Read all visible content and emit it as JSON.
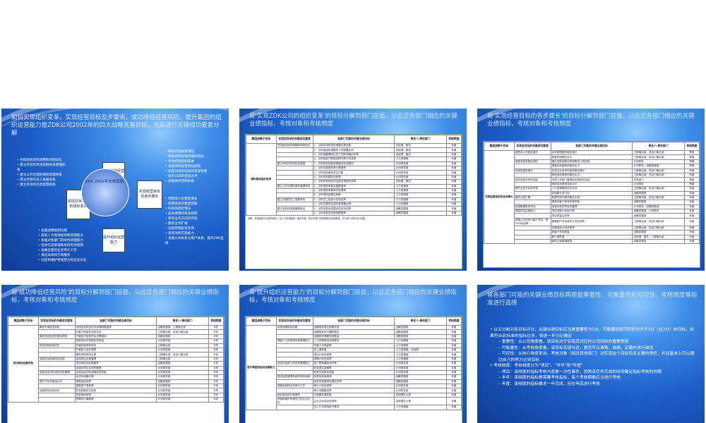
{
  "slides": [
    {
      "title": "如何实现组织变革，实现经营目标及步骤表，成功降低经营风险，提升集团的组织运营能力是ZDK公司2002年的四大战略发展目标，对其进行关键成功要素分解",
      "center": "ZDK 2002年总体目标",
      "boxes": {
        "top": "成功降低经营风险",
        "left": "实现ZDK公司的组织变革",
        "right": "实现经营目标的各步骤长",
        "bottom": "提升组织运营能力"
      },
      "left_list": [
        "完成组织结构调整和体制优化",
        "建立有效的风险控制体系管理体系",
        "建立公开合理的绩效管理体系",
        "建立完善的员工发展体系",
        "建立有效的信息管理系统"
      ],
      "right_list": [
        "降低市场投资风险",
        "降低项目投资的整体风险",
        "有效控制控制成本",
        "加强项目经营风险控制",
        "加强对经济利润的有效管理",
        "提升ZDK的营运水平",
        "加强财务控制体系"
      ],
      "right_list2": [
        "销售收入的稳定增长",
        "使营收息的稳定回收",
        "利润的稳定增长",
        "成本费用的有效控制",
        "新的业务方向的开拓",
        "服务业务扩展",
        "加强管理投资项目",
        "提高项目实施能力",
        "发展公共关系与客户关系，提升ZDK品牌"
      ],
      "bottom_list": [
        "加强战略规划功能",
        "提高人力资源规划和管理能力",
        "加强对各部门的财务管理能力",
        "促进信息管理系统的有效使用",
        "准确全面的业务审计工作",
        "保证高效的行政服务",
        "创造和维护有规范力的企业文化"
      ]
    },
    {
      "title": "将'实现ZDK公司的组织变革'的目标分解到部门层面，以此定各部门相应的关键业绩指标，考核对象和考核频度",
      "headers": [
        "集团战略子目标",
        "实现该目标的关键成功要素",
        "各部门可能的关键业绩目标",
        "责任人/责任部门",
        "考核频度"
      ],
      "group": "顺利推进组织变革",
      "rows": [
        [
          "完成组织结构调整和体制优化",
          "1、当前年组织架构调整实施进度",
          "总经理、副总",
          "年度"
        ],
        [
          "",
          "2、当年度组织调整的人员配置比例",
          "总经理、副总",
          "年度"
        ],
        [
          "",
          "3、当年度管理岗位员工任职资格达标率",
          "总经理、副总",
          "年度"
        ],
        [
          "",
          "4、当年各部门职能说明书修订完成率",
          "人力资源部",
          "年度"
        ],
        [
          "建立有效的风险防控制度",
          "1、当年风险控制制度建设完成情况",
          "计划财务部",
          "年度"
        ],
        [
          "",
          "2、当年内部风险审计覆盖率",
          "计划财务部",
          "年度"
        ],
        [
          "",
          "3、当年风险事件发生次数",
          "计划财务部",
          "年度"
        ],
        [
          "",
          "4、当年风险整改完成率",
          "计划财务部",
          "年度"
        ],
        [
          "",
          "5、当年投资风险评估报告按期完成率",
          "总经理、副总",
          "年度"
        ],
        [
          "建立公开合理的绩效管理体系",
          "1、当年绩效考核实施覆盖率",
          "人力资源部",
          "年度"
        ],
        [
          "",
          "2、当年绩效考核申诉处理率",
          "人力资源部",
          "年度"
        ],
        [
          "",
          "3、当年绩效结果应用率",
          "人力资源部",
          "年度"
        ],
        [
          "建立完善的员工发展体系",
          "1、当年员工培训计划完成率",
          "人力资源部",
          "年度"
        ],
        [
          "",
          "2、当年关键岗位继任者储备比例",
          "人力资源部",
          "年度"
        ],
        [
          "建立有效的信息管理系统",
          "1、当年信息系统建设项目完成率",
          "战略发展部",
          "年度"
        ],
        [
          "",
          "2、当年信息系统使用覆盖率",
          "战略发展部",
          "年度"
        ]
      ],
      "note": "说明：考核频度为年度的指标，由人力资源部统一组织考核；各责任部门须按期提交考核数据，作为部门绩效评价依据。"
    },
    {
      "title": "将'实现经营目标的各步骤长'的目标分解到部门层面，以此定各部门相应的关键业绩指标，考核对象和考核频度",
      "headers": [
        "集团战略子目标",
        "实现该目标的关键成功要素",
        "各部门可能的关键业绩目标",
        "责任人/责任部门",
        "考核频度"
      ],
      "group": "实现经营目标的各步骤长",
      "rows": [
        [
          "销售收入的稳定增长",
          "实现销售额的稳定增长",
          "工程事业部、进出口事业部",
          "季度"
        ],
        [
          "",
          "提高利润率的水平",
          "工程事业部、进出口事业部",
          "季度"
        ],
        [
          "使营收息的稳定回收",
          "通过控制回款实现销售收入的回收",
          "计划财务",
          "季度"
        ],
        [
          "",
          "提高应收账款的回收水平",
          "计划财务、战略发展部",
          "季度"
        ],
        [
          "利润的稳定增长",
          "实现主业务净利润的稳定增长",
          "工程事业部、进出口事业部",
          "年度"
        ],
        [
          "",
          "降低成本费用的增长水平",
          "工程事业部、进出口事业部",
          "年度"
        ],
        [
          "成本费用的有效控制",
          "本部门本部门管理成本费用的控制",
          "所有部门",
          "季度"
        ],
        [
          "",
          "降低成本费用总体水平",
          "计划财务",
          "季度"
        ],
        [
          "新的业务方向的开拓",
          "人力资源推荐业务方向",
          "工程事业部、进出口事业部",
          "年度"
        ],
        [
          "",
          "实现新业务方向",
          "战略发展部",
          "年度"
        ],
        [
          "服务业务扩展",
          "拓展市场中服务增长比例",
          "工程事业部、进出口事业部",
          "年度"
        ],
        [
          "",
          "提高对客户服务的满意度",
          "战略发展部",
          "年度"
        ],
        [
          "加强管理投资项目",
          "加强对投资项目的管理",
          "计划财务、战略发展部",
          "年度"
        ],
        [
          "提高项目实施能力",
          "项目进度计划执行率",
          "战略发展部、计划财务",
          "年度"
        ],
        [
          "",
          "项目质量达标率",
          "战略发展部",
          "年度"
        ],
        [
          "发展公共关系与客户关系，提升ZDK品牌",
          "重要客户关系维护计划完成率",
          "工程事业部、进出口事业部",
          "年度"
        ],
        [
          "",
          "品牌宣传计划完成率",
          "工程事业部、进出口事业部",
          "年度"
        ],
        [
          "",
          "新客户开发数量",
          "战略发展部",
          "年度"
        ],
        [
          "",
          "客户满意度",
          "总经理、副总、工程事业部",
          "年度"
        ],
        [
          "",
          "媒体正面报道数量",
          "战略发展部",
          "年度"
        ]
      ]
    },
    {
      "title": "将'成功降低经营风险'的目标分解到部门层面，以此定各部门相应的关键业绩指标，考核对象和考核频度",
      "headers": [
        "集团战略子目标",
        "实现该目标的关键成功要素",
        "各部门可能的关键业绩目标",
        "责任人/责任部门",
        "考核频度"
      ],
      "group": "成功降低经营风险",
      "rows": [
        [
          "降低市场投资风险",
          "对拟投资项目的市场调研覆盖率",
          "战略发展部、工程事业部",
          "半年"
        ],
        [
          "",
          "对客户信用状况的评估",
          "工程事业部、进出口事业部",
          "半年"
        ],
        [
          "降低项目投资的整体风险",
          "严格执行投资项目决策程序",
          "战略发展部",
          "半年"
        ],
        [
          "",
          "提高项目可研报告的质量",
          "计划财务部",
          "半年"
        ],
        [
          "有效控制控制成本",
          "严格控制采购成本",
          "工程事业部",
          "半年"
        ],
        [
          "",
          "严格执行成本预算",
          "计划财务部",
          "半年"
        ],
        [
          "",
          "降低采购成本比率",
          "工程事业部、进出口事业部",
          "半年"
        ],
        [
          "加强项目经营风险控制",
          "加强项目过程管理",
          "工程事业部",
          "半年"
        ],
        [
          "",
          "项目风险评估覆盖率",
          "战略发展部",
          "半年"
        ],
        [
          "",
          "加强对项目合同的管理",
          "计划财务部",
          "半年"
        ],
        [
          "加强对经济利润的有效管理",
          "加强对经济利润指标的控制",
          "计划财务部",
          "半年"
        ],
        [
          "",
          "经济利润增长率",
          "计划财务部",
          "半年"
        ],
        [
          "提升ZDK的营运水平",
          "提高营运效率",
          "战略发展部",
          "半年"
        ],
        [
          "",
          "提高资产周转率",
          "计划财务部",
          "半年"
        ],
        [
          "加强财务控制体系",
          "财务制度执行检查",
          "计划财务部",
          "半年"
        ],
        [
          "",
          "资金使用效率",
          "计划财务部",
          "半年"
        ],
        [
          "",
          "预算执行偏差率",
          "计划财务部",
          "半年"
        ]
      ]
    },
    {
      "title": "将'提升组织运营能力'的目标分解到部门层面，以此定各部门相应的关键业绩指标，考核对象和考核频度",
      "headers": [
        "集团战略子目标",
        "实现该目标的关键成功要素",
        "各部门可能的关键业绩目标",
        "责任人/责任部门",
        "考核频度"
      ],
      "group": "提升集团的组织运营能力",
      "rows": [
        [
          "加强战略规划功能",
          "战略规划报告按期完成",
          "战略发展部",
          "年度"
        ],
        [
          "",
          "战略规划执行跟踪报告",
          "战略发展部",
          "年度"
        ],
        [
          "",
          "战略研究课题完成数量",
          "战略发展部",
          "年度"
        ],
        [
          "提高人力资源规划和管理能力",
          "人力资源规划完成情况",
          "人力资源部",
          "年度"
        ],
        [
          "",
          "关键人才保留率",
          "人力资源部",
          "年度"
        ],
        [
          "",
          "员工满意度",
          "人力资源部、总经理",
          "年度"
        ],
        [
          "",
          "培训计划完成率",
          "人力资源部",
          "年度"
        ],
        [
          "",
          "招聘计划完成率",
          "人力资源部",
          "年度"
        ],
        [
          "加强对各部门的财务管理能力",
          "部门预算编制及时率",
          "计划财务部",
          "年度"
        ],
        [
          "",
          "财务报告准确率",
          "计划财务部",
          "年度"
        ],
        [
          "",
          "财务分析报告质量",
          "计划财务部",
          "年度"
        ],
        [
          "促进信息管理系统的有效使用",
          "信息系统使用率",
          "战略发展部",
          "年度"
        ],
        [
          "",
          "信息系统故障处理及时率",
          "战略发展部",
          "年度"
        ],
        [
          "准确全面的业务审计工作",
          "审计计划完成率",
          "计划财务部",
          "年度"
        ],
        [
          "",
          "审计问题整改率",
          "计划财务部",
          "年度"
        ],
        [
          "保证高效的行政服务",
          "行政服务满意度",
          "总经理办公室",
          "年度"
        ],
        [
          "创造和维护有规范力的企业文化",
          "企业文化活动完成率",
          "总经理办公室",
          "年度"
        ],
        [
          "",
          "员工行为规范执行情况",
          "人力资源部",
          "年度"
        ]
      ]
    },
    {
      "title": "将各部门可能的关键业绩目标再根据重要性、可衡量性和可控性、考核频度等标准进行选择",
      "bullets": [
        {
          "level": 1,
          "text": "以五分制对各目标评分，关键业绩目标应当是重要性为5分，可衡量性和可控性均大于3分（含3分）的目标。如果符合此标准的指标过多，将进一步讨论确定"
        },
        {
          "level": 2,
          "text": "重要性：从公司角度看，该目标对于实现其对应的公司目标的重要程度"
        },
        {
          "level": 2,
          "text": "可衡量性：从考核角度看，该目标实现与否，是否可以清晰、准确、定量的进行描述"
        },
        {
          "level": 2,
          "text": "可控性：从执行角度来讲，考核对象（相对其他部门）对实现这个目标负有主要的责任，并且基本上可以通过自己的努力达到目标"
        },
        {
          "level": 1,
          "text": "考核频度：考核频度分为\"项目\"、\"半年\"和\"年度\""
        },
        {
          "level": 2,
          "text": "项目：该频度的指标考核内容是一次性事件，按照该任务完成的时间确定指标考核的时期"
        },
        {
          "level": 2,
          "text": "半年：该频度的指标是需要考核指标，每个考核期都应当进行考核"
        },
        {
          "level": 2,
          "text": "年度：该频度的指标要求一年完成，应在年底进行考核"
        }
      ]
    }
  ]
}
